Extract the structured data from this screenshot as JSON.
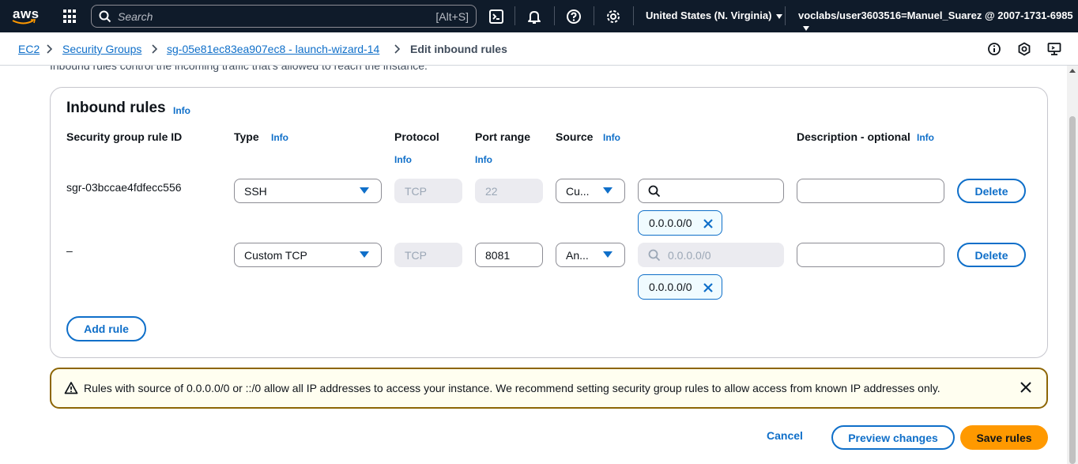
{
  "topnav": {
    "logo_text": "aws",
    "search_placeholder": "Search",
    "search_shortcut": "[Alt+S]",
    "region": "United States (N. Virginia)",
    "account": "voclabs/user3603516=Manuel_Suarez @ 2007-1731-6985",
    "icons": [
      "grid-icon",
      "search-icon",
      "cloudshell-icon",
      "bell-icon",
      "help-icon",
      "gear-icon"
    ]
  },
  "breadcrumb": {
    "items": [
      "EC2",
      "Security Groups",
      "sg-05e81ec83ea907ec8 - launch-wizard-14"
    ],
    "current": "Edit inbound rules"
  },
  "intro_text": "Inbound rules control the incoming traffic that's allowed to reach the instance.",
  "inbound": {
    "title": "Inbound rules",
    "info": "Info",
    "columns": {
      "rule_id": "Security group rule ID",
      "type": "Type",
      "protocol": "Protocol",
      "port_range": "Port range",
      "source": "Source",
      "description": "Description - optional"
    },
    "rules": [
      {
        "rule_id": "sgr-03bccae4fdfecc556",
        "type": "SSH",
        "protocol": "TCP",
        "port_range": "22",
        "source": "Cu...",
        "source_search_placeholder": "",
        "cidr_token": "0.0.0.0/0",
        "description": "",
        "delete_label": "Delete"
      },
      {
        "rule_id": "–",
        "type": "Custom TCP",
        "protocol": "TCP",
        "port_range": "8081",
        "source": "An...",
        "source_search_placeholder": "0.0.0.0/0",
        "cidr_token": "0.0.0.0/0",
        "description": "",
        "delete_label": "Delete"
      }
    ],
    "add_rule_label": "Add rule"
  },
  "warning": {
    "text": "Rules with source of 0.0.0.0/0 or ::/0 allow all IP addresses to access your instance. We recommend setting security group rules to allow access from known IP addresses only."
  },
  "footer": {
    "cancel": "Cancel",
    "preview": "Preview changes",
    "save": "Save rules"
  },
  "colors": {
    "nav_bg": "#0f1b2a",
    "link": "#0f6fc9",
    "primary": "#ff9900",
    "warning_border": "#8d6605"
  }
}
